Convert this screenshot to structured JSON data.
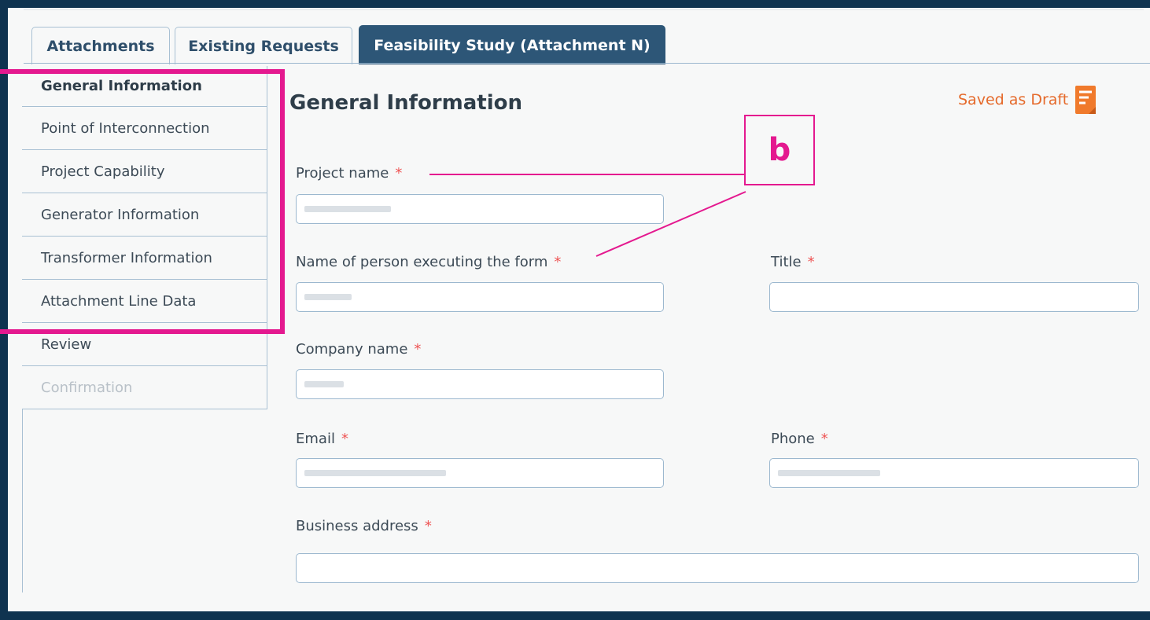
{
  "tabs": [
    {
      "label": "Attachments",
      "active": false
    },
    {
      "label": "Existing Requests",
      "active": false
    },
    {
      "label": "Feasibility Study (Attachment N)",
      "active": true
    }
  ],
  "sidebar": {
    "items": [
      {
        "label": "General Information",
        "state": "current"
      },
      {
        "label": "Point of Interconnection",
        "state": "enabled"
      },
      {
        "label": "Project Capability",
        "state": "enabled"
      },
      {
        "label": "Generator Information",
        "state": "enabled"
      },
      {
        "label": "Transformer Information",
        "state": "enabled"
      },
      {
        "label": "Attachment Line Data",
        "state": "enabled"
      },
      {
        "label": "Review",
        "state": "enabled"
      },
      {
        "label": "Confirmation",
        "state": "disabled"
      }
    ]
  },
  "form": {
    "heading": "General Information",
    "draft_status": "Saved as Draft",
    "required_marker": "*",
    "project_name_label": "Project name",
    "executor_label": "Name of person executing the form",
    "title_label": "Title",
    "company_label": "Company name",
    "email_label": "Email",
    "phone_label": "Phone",
    "address_label": "Business address"
  },
  "annotation": {
    "callout_letter": "b"
  },
  "colors": {
    "accent_tab": "#2d5677",
    "highlight": "#e4198f",
    "draft": "#e56a2b"
  }
}
